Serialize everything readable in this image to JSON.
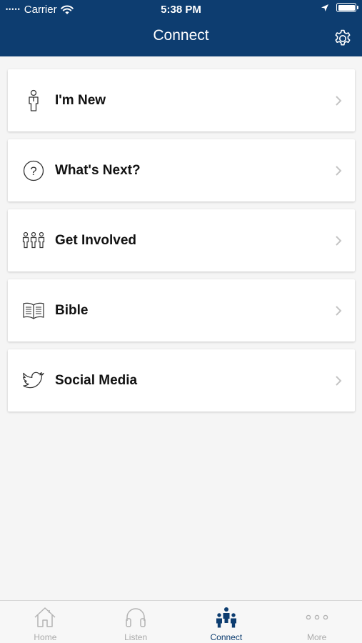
{
  "status_bar": {
    "carrier": "Carrier",
    "time": "5:38 PM"
  },
  "header": {
    "title": "Connect"
  },
  "menu": [
    {
      "label": "I'm New",
      "icon": "person-icon"
    },
    {
      "label": "What's Next?",
      "icon": "question-icon"
    },
    {
      "label": "Get Involved",
      "icon": "group-icon"
    },
    {
      "label": "Bible",
      "icon": "book-icon"
    },
    {
      "label": "Social Media",
      "icon": "twitter-icon"
    }
  ],
  "tabs": [
    {
      "label": "Home",
      "icon": "home-icon",
      "active": false
    },
    {
      "label": "Listen",
      "icon": "headphones-icon",
      "active": false
    },
    {
      "label": "Connect",
      "icon": "connect-icon",
      "active": true
    },
    {
      "label": "More",
      "icon": "more-icon",
      "active": false
    }
  ],
  "colors": {
    "header_bg": "#0d3d70",
    "active_tab": "#0d3d70",
    "inactive_tab": "#aaaaaa",
    "page_bg": "#f5f5f5"
  }
}
